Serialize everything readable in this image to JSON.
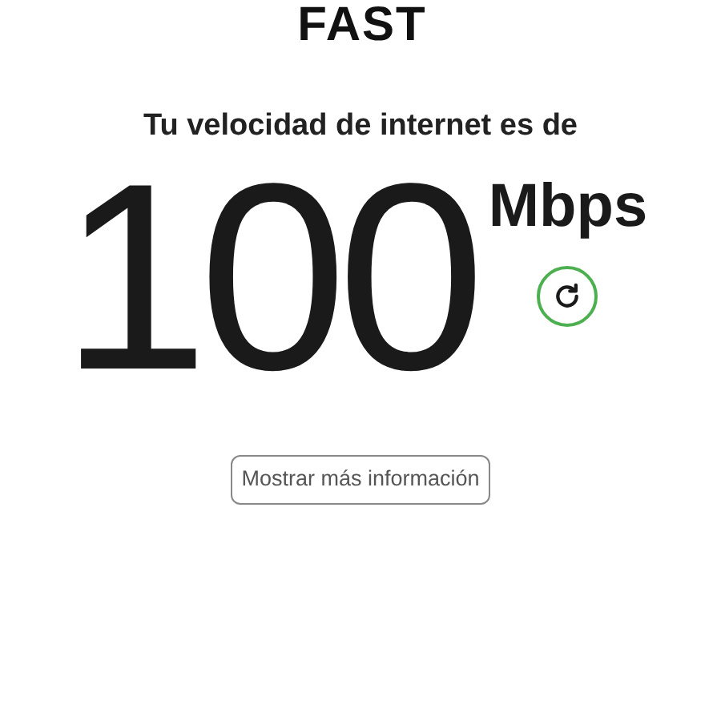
{
  "logo": {
    "text": "FAST"
  },
  "heading": "Tu velocidad de internet es de",
  "speed": {
    "value": "100",
    "unit": "Mbps"
  },
  "more_info_button": "Mostrar más información"
}
